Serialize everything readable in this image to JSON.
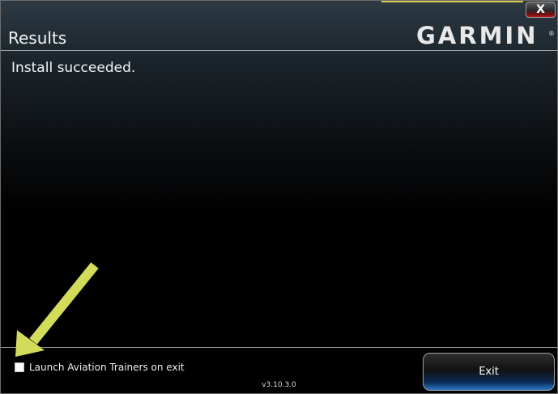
{
  "window": {
    "close_label": "X",
    "title": "Results",
    "brand": "GARMIN",
    "brand_mark": "®"
  },
  "main": {
    "message": "Install succeeded."
  },
  "footer": {
    "launch_label": "Launch Aviation Trainers on exit",
    "launch_checked": false,
    "version": "v3.10.3.0",
    "exit_label": "Exit"
  },
  "colors": {
    "annotation_arrow": "#d2dc5a",
    "exit_accent": "#2a75c8",
    "close_accent": "#c01818"
  }
}
